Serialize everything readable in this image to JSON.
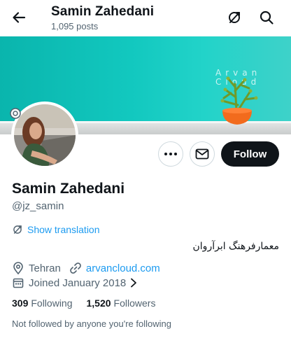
{
  "header": {
    "title": "Samin Zahedani",
    "subtitle": "1,095 posts",
    "icons": [
      "back-arrow-icon",
      "translate-icon",
      "search-icon"
    ]
  },
  "banner": {
    "watermark": "Arvan Cloud",
    "accent_color": "#12c8bf"
  },
  "actions": {
    "follow_label": "Follow",
    "more_icon": "more-options-icon",
    "message_icon": "mail-icon"
  },
  "profile": {
    "name": "Samin Zahedani",
    "handle": "@jz_samin",
    "show_translation": "Show translation",
    "bio": "معمارفرهنگ ابرآروان",
    "location": "Tehran",
    "website": "arvancloud.com",
    "joined": "Joined January 2018"
  },
  "stats": {
    "following_count": "309",
    "following_label": "Following",
    "followers_count": "1,520",
    "followers_label": "Followers"
  },
  "followed_by": "Not followed by anyone you're following",
  "colors": {
    "link": "#1d9bf0",
    "text": "#0f1419",
    "muted": "#536471",
    "button_dark": "#0f1419"
  }
}
